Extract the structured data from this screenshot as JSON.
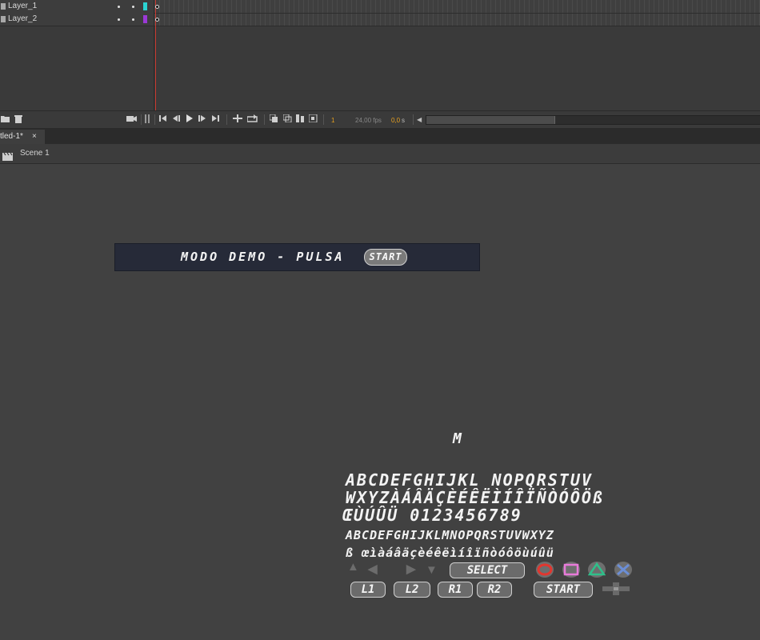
{
  "timeline": {
    "layers": [
      {
        "name": "Layer_1",
        "color": "#2bd4d2"
      },
      {
        "name": "Layer_2",
        "color": "#9b39d6"
      }
    ],
    "controls": {
      "current_frame": "1",
      "fps": "24,00 fps",
      "time": "0,0",
      "time_unit": "s"
    }
  },
  "document": {
    "tab_label": "tled-1*",
    "close_glyph": "×"
  },
  "scene": {
    "label": "Scene 1"
  },
  "stage": {
    "banner_text": "MODO DEMO  -  PULSA",
    "banner_button": "START",
    "single_glyph": "M",
    "font_lines": [
      "ABCDEFGHIJKL NOPQRSTUV",
      "WXYZÀÁÂÄÇÈÉÊËÌÍÎÏÑÒÓÔÖß",
      "ŒÙÚÛÜ   0123456789",
      "ABCDEFGHIJKLMNOPQRSTUVWXYZ",
      "ß  œìàáâäçèéêëìíîïñòóôöùúûü"
    ],
    "select_label": "SELECT",
    "start_label": "START",
    "shoulder_buttons": [
      "L1",
      "L2",
      "R1",
      "R2"
    ]
  },
  "colors": {
    "circle": "#e2362f",
    "square": "#e87ad9",
    "triangle": "#2fbf8a",
    "cross": "#6b8ed6"
  }
}
